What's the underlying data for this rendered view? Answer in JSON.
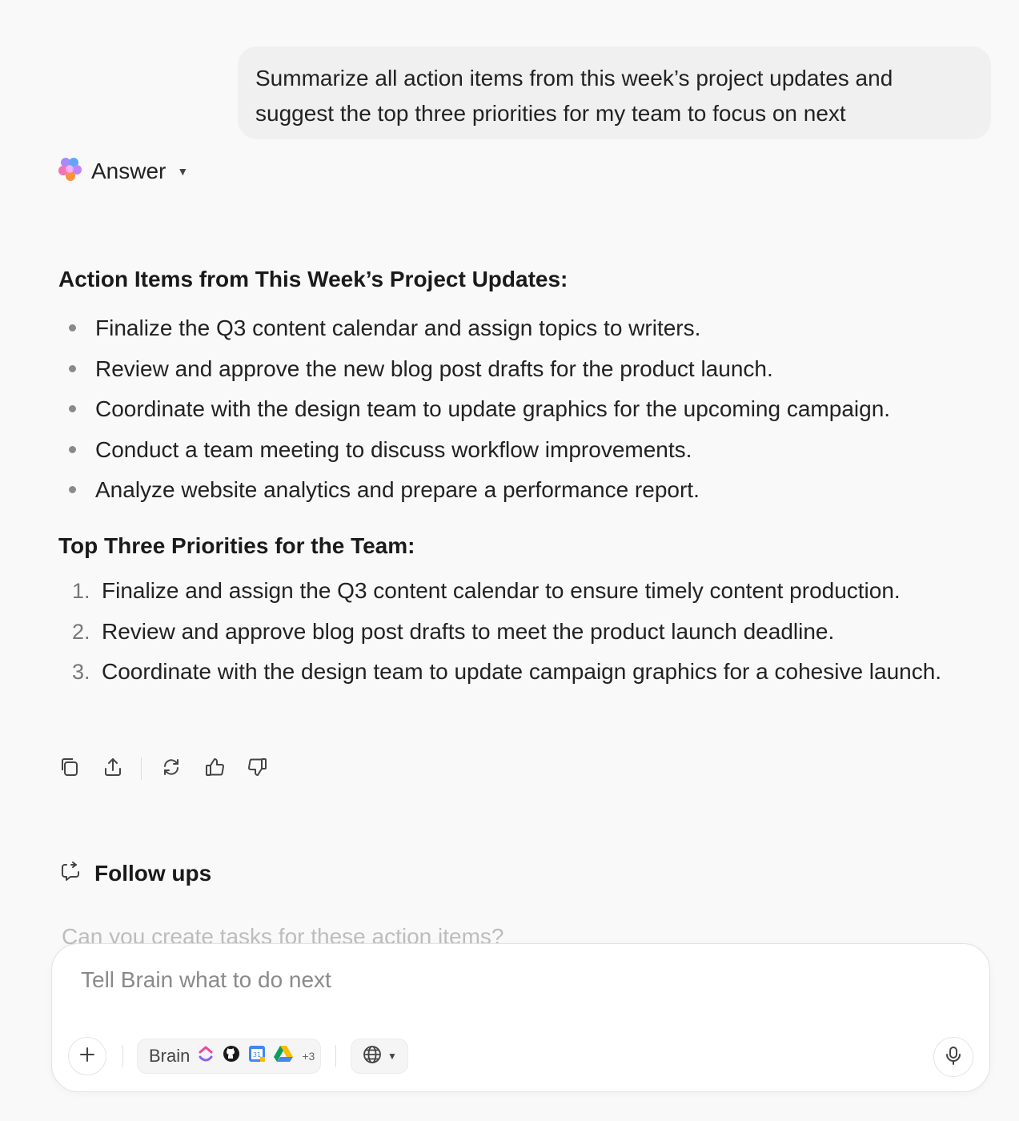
{
  "user_message": "Summarize all action items from this week’s project updates and suggest the top three priorities for my team to focus on next",
  "answer_header": {
    "label": "Answer",
    "icon": "brain-logo-icon"
  },
  "action_items": {
    "heading": "Action Items from This Week’s Project Updates:",
    "items": [
      "Finalize the Q3 content calendar and assign topics to writers.",
      "Review and approve the new blog post drafts for the product launch.",
      "Coordinate with the design team to update graphics for the upcoming campaign.",
      "Conduct a team meeting to discuss workflow improvements.",
      "Analyze website analytics and prepare a performance report."
    ]
  },
  "priorities": {
    "heading": "Top Three Priorities for the Team:",
    "items": [
      {
        "num": "1.",
        "text": "Finalize and assign the Q3 content calendar to ensure timely content production."
      },
      {
        "num": "2.",
        "text": "Review and approve blog post drafts to meet the product launch deadline."
      },
      {
        "num": "3.",
        "text": "Coordinate with the design team to update campaign graphics for a cohesive launch."
      }
    ]
  },
  "message_actions": [
    "copy-icon",
    "share-icon",
    "regenerate-icon",
    "thumbs-up-icon",
    "thumbs-down-icon"
  ],
  "followups": {
    "heading": "Follow ups",
    "suggestion": "Can you create tasks for these action items?"
  },
  "composer": {
    "placeholder": "Tell Brain what to do next",
    "brain_chip_label": "Brain",
    "more_sources": "+3",
    "source_icons": [
      "clickup-icon",
      "github-icon",
      "google-calendar-icon",
      "google-drive-icon"
    ]
  },
  "colors": {
    "page_bg": "#f9f9f9",
    "bubble_bg": "#f0f0f0",
    "text": "#222222",
    "muted": "#8a8a8a"
  }
}
